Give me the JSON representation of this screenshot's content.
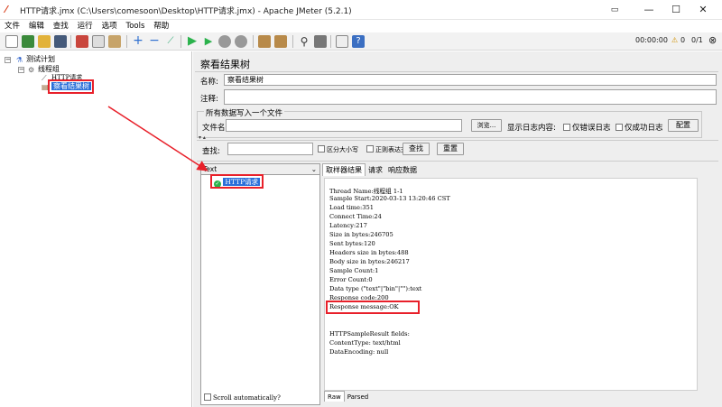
{
  "window": {
    "title": "HTTP请求.jmx (C:\\Users\\comesoon\\Desktop\\HTTP请求.jmx) - Apache JMeter (5.2.1)",
    "minimize": "—",
    "maximize": "☐",
    "close": "✕"
  },
  "menu": [
    "文件",
    "编辑",
    "查找",
    "运行",
    "选项",
    "Tools",
    "帮助"
  ],
  "toolbar": {
    "timer": "00:00:00",
    "warning_count": "0",
    "thread_count": "0/1"
  },
  "tree": {
    "root": "测试计划",
    "thread_group": "线程组",
    "http_request": "HTTP请求",
    "listener": "察看结果树"
  },
  "panel": {
    "title": "察看结果树",
    "name_label": "名称:",
    "name_value": "察看结果树",
    "comment_label": "注释:",
    "comment_value": "",
    "file_group_title": "所有数据写入一个文件",
    "filename_label": "文件名",
    "filename_value": "",
    "browse_button": "浏览...",
    "log_content_label": "显示日志内容:",
    "errors_only": "仅错误日志",
    "success_only": "仅成功日志",
    "configure_button": "配置"
  },
  "search": {
    "label": "查找:",
    "value": "",
    "case_sensitive": "区分大小写",
    "regex": "正则表达式",
    "find_button": "查找",
    "reset_button": "重置"
  },
  "results": {
    "renderer": "Text",
    "sample_label": "HTTP请求",
    "scroll_auto": "Scroll automatically?",
    "tabs": [
      "取样器结果",
      "请求",
      "响应数据"
    ],
    "bottom_tabs": [
      "Raw",
      "Parsed"
    ],
    "lines": [
      "Thread Name:线程组 1-1",
      "Sample Start:2020-03-13 13:20:46 CST",
      "Load time:351",
      "Connect Time:24",
      "Latency:217",
      "Size in bytes:246705",
      "Sent bytes:120",
      "Headers size in bytes:488",
      "Body size in bytes:246217",
      "Sample Count:1",
      "Error Count:0",
      "Data type (\"text\"|\"bin\"|\"\"):text",
      "Response code:200",
      "Response message:OK",
      "",
      "",
      "HTTPSampleResult fields:",
      "ContentType: text/html",
      "DataEncoding: null"
    ]
  },
  "colors": {
    "annotation_red": "#e8202a",
    "selection_blue": "#2a6fd9",
    "success_green": "#2bb24c"
  }
}
